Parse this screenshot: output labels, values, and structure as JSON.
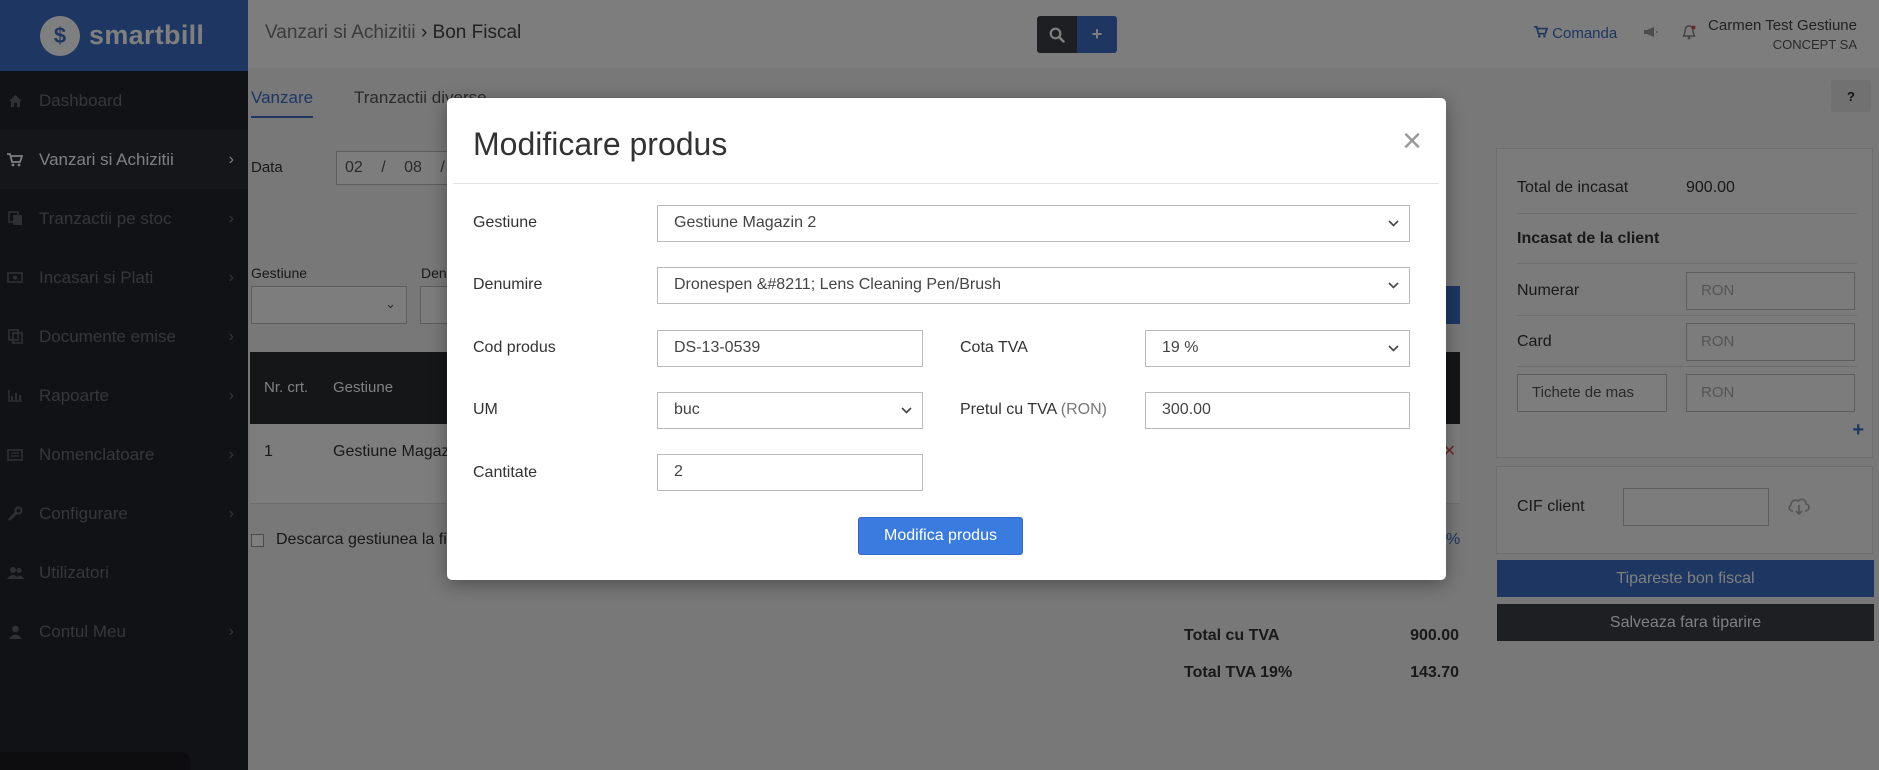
{
  "brand": {
    "logo_glyph": "$",
    "name": "smartbill",
    "color": "#3a6fc4"
  },
  "sidebar": {
    "items": [
      {
        "label": "Dashboard",
        "icon": "home-icon",
        "chevron": false
      },
      {
        "label": "Vanzari si Achizitii",
        "icon": "cart-icon",
        "chevron": true,
        "active": true
      },
      {
        "label": "Tranzactii pe stoc",
        "icon": "copy-icon",
        "chevron": true
      },
      {
        "label": "Incasari si Plati",
        "icon": "money-icon",
        "chevron": true
      },
      {
        "label": "Documente emise",
        "icon": "file-icon",
        "chevron": true
      },
      {
        "label": "Rapoarte",
        "icon": "bar-chart-icon",
        "chevron": true
      },
      {
        "label": "Nomenclatoare",
        "icon": "list-icon",
        "chevron": true
      },
      {
        "label": "Configurare",
        "icon": "wrench-icon",
        "chevron": true
      },
      {
        "label": "Utilizatori",
        "icon": "users-icon",
        "chevron": false
      },
      {
        "label": "Contul Meu",
        "icon": "user-icon",
        "chevron": true
      }
    ]
  },
  "header": {
    "breadcrumb_parent": "Vanzari si Achizitii",
    "breadcrumb_sep": "›",
    "breadcrumb_current": "Bon Fiscal",
    "comanda_label": "Comanda",
    "user_name": "Carmen Test Gestiune",
    "company": "CONCEPT SA"
  },
  "tabs": [
    {
      "label": "Vanzare",
      "active": true
    },
    {
      "label": "Tranzactii diverse",
      "active": false
    }
  ],
  "form_bg": {
    "data_label": "Data",
    "date_day": "02",
    "date_month": "08",
    "date_sep": "/",
    "gestiune_label": "Gestiune",
    "denumire_label_partial": "Den"
  },
  "table_bg": {
    "col_nr": "Nr. crt.",
    "col_gestiune": "Gestiune",
    "row_nr": "1",
    "row_gestiune": "Gestiune Magaz",
    "descarca_label": "Descarca gestiunea la fir",
    "percent_partial": "%"
  },
  "totals": {
    "total_cu_tva_label": "Total cu TVA",
    "total_cu_tva": "900.00",
    "total_tva_label": "Total TVA 19%",
    "total_tva": "143.70"
  },
  "right_panel": {
    "total_incasat_label": "Total de incasat",
    "total_incasat": "900.00",
    "incasat_title": "Incasat de la client",
    "numerar_label": "Numerar",
    "card_label": "Card",
    "tichete_label": "Tichete de mas",
    "ron_placeholder": "RON",
    "cif_label": "CIF client",
    "print_button": "Tipareste bon fiscal",
    "save_button": "Salveaza fara tiparire"
  },
  "modal": {
    "title": "Modificare produs",
    "close_glyph": "×",
    "gestiune_label": "Gestiune",
    "gestiune_value": "Gestiune Magazin 2",
    "denumire_label": "Denumire",
    "denumire_value": "Dronespen &#8211; Lens Cleaning Pen/Brush",
    "cod_label": "Cod produs",
    "cod_value": "DS-13-0539",
    "cota_label": "Cota TVA",
    "cota_value": "19 %",
    "um_label": "UM",
    "um_value": "buc",
    "pret_label": "Pretul cu TVA",
    "pret_unit": "(RON)",
    "pret_value": "300.00",
    "cantitate_label": "Cantitate",
    "cantitate_value": "2",
    "submit_button": "Modifica produs"
  }
}
